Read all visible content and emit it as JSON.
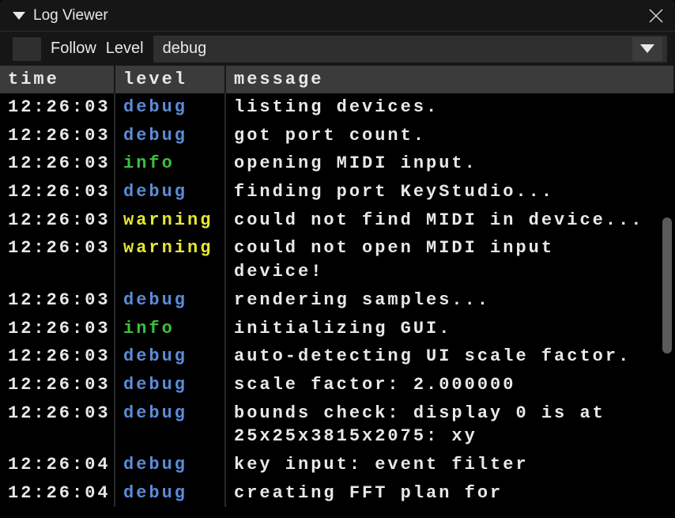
{
  "window": {
    "title": "Log Viewer"
  },
  "toolbar": {
    "follow_label": "Follow",
    "level_label": "Level",
    "level_selected": "debug"
  },
  "table": {
    "headers": {
      "time": "time",
      "level": "level",
      "message": "message"
    },
    "rows": [
      {
        "time": "12:26:03",
        "level": "debug",
        "message": "listing devices."
      },
      {
        "time": "12:26:03",
        "level": "debug",
        "message": "got port count."
      },
      {
        "time": "12:26:03",
        "level": "info",
        "message": "opening MIDI input."
      },
      {
        "time": "12:26:03",
        "level": "debug",
        "message": "finding port KeyStudio..."
      },
      {
        "time": "12:26:03",
        "level": "warning",
        "message": "could not find MIDI in device..."
      },
      {
        "time": "12:26:03",
        "level": "warning",
        "message": "could not open MIDI input device!"
      },
      {
        "time": "12:26:03",
        "level": "debug",
        "message": "rendering samples..."
      },
      {
        "time": "12:26:03",
        "level": "info",
        "message": "initializing GUI."
      },
      {
        "time": "12:26:03",
        "level": "debug",
        "message": "auto-detecting UI scale factor."
      },
      {
        "time": "12:26:03",
        "level": "debug",
        "message": "scale factor: 2.000000"
      },
      {
        "time": "12:26:03",
        "level": "debug",
        "message": "bounds check: display 0 is at 25x25x3815x2075: xy"
      },
      {
        "time": "12:26:04",
        "level": "debug",
        "message": "key input: event filter"
      },
      {
        "time": "12:26:04",
        "level": "debug",
        "message": "creating FFT plan for"
      }
    ]
  }
}
